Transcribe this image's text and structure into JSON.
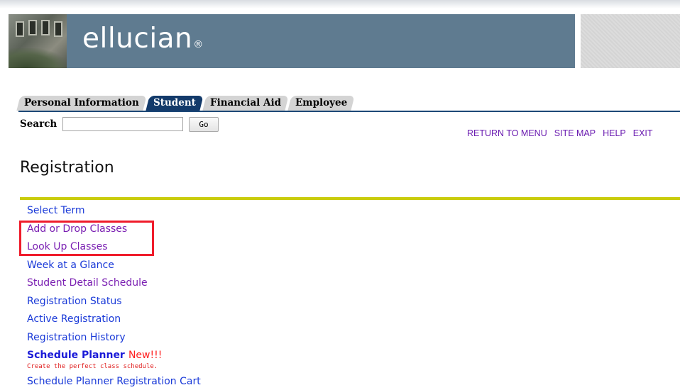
{
  "header": {
    "logo_text": "ellucian",
    "logo_mark": "®"
  },
  "tabs": [
    {
      "label": "Personal Information",
      "active": false
    },
    {
      "label": "Student",
      "active": true
    },
    {
      "label": "Financial Aid",
      "active": false
    },
    {
      "label": "Employee",
      "active": false
    }
  ],
  "search": {
    "label": "Search",
    "value": "",
    "button_label": "Go"
  },
  "top_links": {
    "return_to_menu": "RETURN TO MENU",
    "site_map": "SITE MAP",
    "help": "HELP",
    "exit": "EXIT"
  },
  "page": {
    "title": "Registration"
  },
  "menu": {
    "items": [
      {
        "label": "Select Term",
        "visited": false
      },
      {
        "label": "Add or Drop Classes",
        "visited": true
      },
      {
        "label": "Look Up Classes",
        "visited": true
      },
      {
        "label": "Week at a Glance",
        "visited": false
      },
      {
        "label": "Student Detail Schedule",
        "visited": true
      },
      {
        "label": "Registration Status",
        "visited": false
      },
      {
        "label": "Active Registration",
        "visited": false
      },
      {
        "label": "Registration History",
        "visited": false
      }
    ],
    "planner": {
      "title": "Schedule Planner",
      "badge": "New!!!",
      "description": "Create the perfect class schedule."
    },
    "cart_label": "Schedule Planner Registration Cart"
  },
  "colors": {
    "banner": "#5f7b90",
    "active_tab": "#133a6a",
    "highlight": "#ef1c2b",
    "rule": "#c9cc0b"
  }
}
